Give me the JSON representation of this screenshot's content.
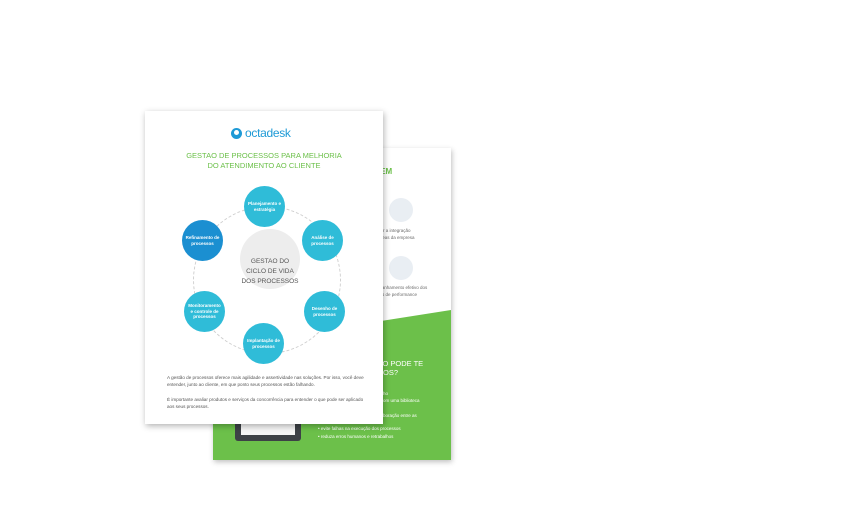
{
  "back_page": {
    "header": "IR EM",
    "item1": [
      "lhorar a integração",
      "re áreas da empresa"
    ],
    "item2": [
      "ompanhamento efetivo dos",
      "dores de performance"
    ],
    "green_heading": [
      "TO PODE TE",
      "SOS?"
    ],
    "green_lines": [
      "ho",
      "om uma biblioteca",
      "boração entre as"
    ],
    "bullets": [
      "• evite falhas na execução dos processos",
      "• reduza erros humanos e retrabalhos"
    ]
  },
  "front_page": {
    "brand": "octadesk",
    "title_line1": "GESTAO DE PROCESSOS PARA MELHORIA",
    "title_line2": "DO ATENDIMENTO AO CLIENTE",
    "center_label": [
      "GESTAO DO",
      "CICLO DE VIDA",
      "DOS PROCESSOS"
    ],
    "nodes": {
      "planejamento": "Planejamento e estratégia",
      "analise": "Análise de processos",
      "desenho": "Desenho de processos",
      "implantacao": "Implantação de processos",
      "monitoramento": "Monitoramento e controle de processos",
      "refinamento": "Refinamento de processos"
    },
    "paragraph1": "A gestão de processos oferece mais agilidade e assertividade nas soluções. Por isso, você deve entender, junto ao cliente, em que ponto seus processos estão falhando.",
    "paragraph2": "É importante avaliar produtos e serviços da concorrência para entender o que pode ser aplicado aos seus processos."
  },
  "colors": {
    "green": "#6cc04a",
    "blue": "#1e9ad6",
    "cyan": "#2fbcd8"
  }
}
